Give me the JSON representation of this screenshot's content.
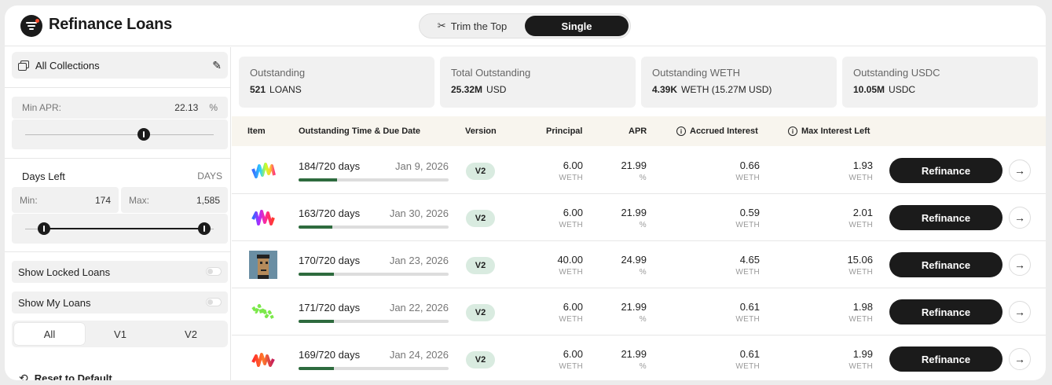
{
  "header": {
    "title": "Refinance Loans",
    "toggle": {
      "trim_label": "Trim the Top",
      "single_label": "Single",
      "selected": "Single"
    }
  },
  "sidebar": {
    "collection_label": "All Collections",
    "min_apr": {
      "label": "Min APR:",
      "value": "22.13",
      "unit": "%",
      "slider_fraction": 0.58
    },
    "days_left": {
      "label": "Days Left",
      "unit": "DAYS",
      "min_label": "Min:",
      "min_value": "174",
      "max_label": "Max:",
      "max_value": "1,585",
      "range_low_fraction": 0.1,
      "range_high_fraction": 0.95
    },
    "show_locked": {
      "label": "Show Locked Loans",
      "on": false
    },
    "show_mine": {
      "label": "Show My Loans",
      "on": false
    },
    "version_filter": {
      "options": [
        "All",
        "V1",
        "V2"
      ],
      "selected": "All"
    },
    "reset_label": "Reset to Default"
  },
  "stats": [
    {
      "label": "Outstanding",
      "value": "521",
      "unit": "LOANS"
    },
    {
      "label": "Total Outstanding",
      "value": "25.32M",
      "unit": "USD"
    },
    {
      "label": "Outstanding WETH",
      "value": "4.39K",
      "unit": "WETH (15.27M USD)"
    },
    {
      "label": "Outstanding USDC",
      "value": "10.05M",
      "unit": "USDC"
    }
  ],
  "table": {
    "columns": [
      "Item",
      "Outstanding Time & Due Date",
      "Version",
      "Principal",
      "APR",
      "Accrued Interest",
      "Max Interest Left"
    ],
    "rows": [
      {
        "days": "184/720 days",
        "date": "Jan 9, 2026",
        "progress": 0.256,
        "version": "V2",
        "principal": "6.00",
        "principal_unit": "WETH",
        "apr": "21.99",
        "apr_unit": "%",
        "accrued": "0.66",
        "accrued_unit": "WETH",
        "max_left": "1.93",
        "max_left_unit": "WETH",
        "action": "Refinance",
        "art": "squiggle-1"
      },
      {
        "days": "163/720 days",
        "date": "Jan 30, 2026",
        "progress": 0.226,
        "version": "V2",
        "principal": "6.00",
        "principal_unit": "WETH",
        "apr": "21.99",
        "apr_unit": "%",
        "accrued": "0.59",
        "accrued_unit": "WETH",
        "max_left": "2.01",
        "max_left_unit": "WETH",
        "action": "Refinance",
        "art": "squiggle-2"
      },
      {
        "days": "170/720 days",
        "date": "Jan 23, 2026",
        "progress": 0.236,
        "version": "V2",
        "principal": "40.00",
        "principal_unit": "WETH",
        "apr": "24.99",
        "apr_unit": "%",
        "accrued": "4.65",
        "accrued_unit": "WETH",
        "max_left": "15.06",
        "max_left_unit": "WETH",
        "action": "Refinance",
        "art": "punk"
      },
      {
        "days": "171/720 days",
        "date": "Jan 22, 2026",
        "progress": 0.238,
        "version": "V2",
        "principal": "6.00",
        "principal_unit": "WETH",
        "apr": "21.99",
        "apr_unit": "%",
        "accrued": "0.61",
        "accrued_unit": "WETH",
        "max_left": "1.98",
        "max_left_unit": "WETH",
        "action": "Refinance",
        "art": "squiggle-3"
      },
      {
        "days": "169/720 days",
        "date": "Jan 24, 2026",
        "progress": 0.235,
        "version": "V2",
        "principal": "6.00",
        "principal_unit": "WETH",
        "apr": "21.99",
        "apr_unit": "%",
        "accrued": "0.61",
        "accrued_unit": "WETH",
        "max_left": "1.99",
        "max_left_unit": "WETH",
        "action": "Refinance",
        "art": "squiggle-4"
      }
    ]
  },
  "colors": {
    "accent": "#1b1b1b",
    "progress": "#2e6b3e",
    "badge": "#d9ebe0",
    "header_bg": "#f8f5ee"
  }
}
